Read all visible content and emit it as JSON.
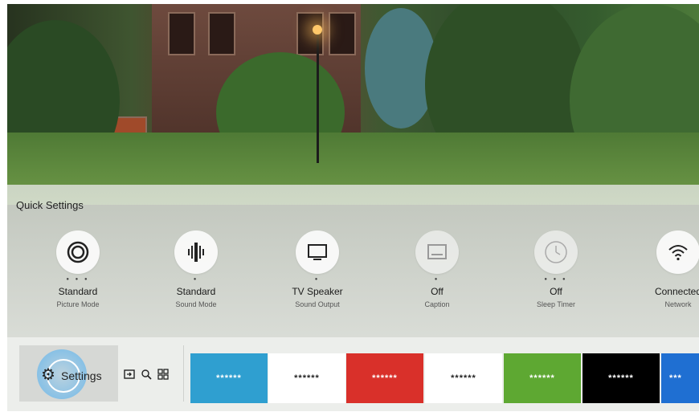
{
  "quick_settings": {
    "title": "Quick Settings",
    "items": [
      {
        "value": "Standard",
        "label": "Picture Mode",
        "icon": "picture-mode-icon"
      },
      {
        "value": "Standard",
        "label": "Sound Mode",
        "icon": "sound-mode-icon"
      },
      {
        "value": "TV Speaker",
        "label": "Sound Output",
        "icon": "tv-speaker-icon"
      },
      {
        "value": "Off",
        "label": "Caption",
        "icon": "caption-icon"
      },
      {
        "value": "Off",
        "label": "Sleep Timer",
        "icon": "sleep-timer-icon"
      },
      {
        "value": "Connected",
        "label": "Network",
        "icon": "wifi-icon"
      }
    ]
  },
  "bottom_bar": {
    "settings_label": "Settings",
    "tools": [
      "source-icon",
      "search-icon",
      "apps-icon"
    ],
    "tiles": [
      {
        "label": "******",
        "bg": "#2f9fd0",
        "fg": "#ffffff"
      },
      {
        "label": "******",
        "bg": "#ffffff",
        "fg": "#222222"
      },
      {
        "label": "******",
        "bg": "#d9302a",
        "fg": "#ffffff"
      },
      {
        "label": "******",
        "bg": "#ffffff",
        "fg": "#222222"
      },
      {
        "label": "******",
        "bg": "#5ea832",
        "fg": "#ffffff"
      },
      {
        "label": "******",
        "bg": "#000000",
        "fg": "#ffffff"
      },
      {
        "label": "***",
        "bg": "#1f6fd2",
        "fg": "#ffffff"
      }
    ]
  }
}
